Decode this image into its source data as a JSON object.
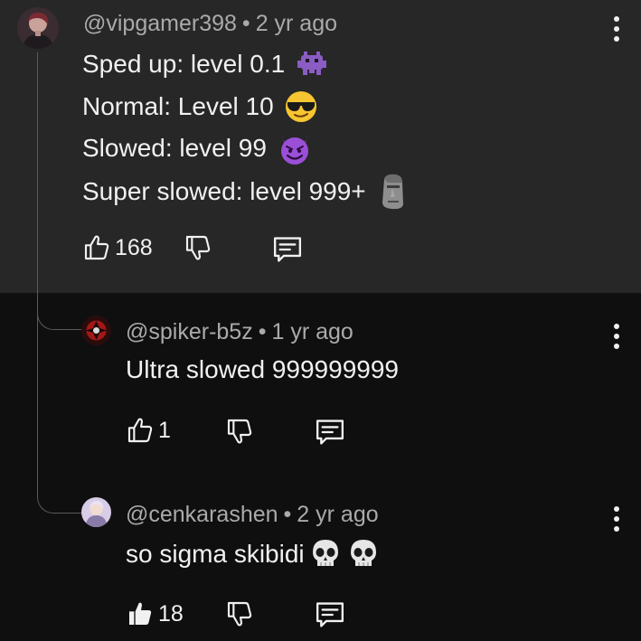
{
  "comments": [
    {
      "author": "@vipgamer398",
      "time": "2 yr ago",
      "lines": [
        "Sped up: level 0.1",
        "Normal: Level 10",
        "Slowed: level 99",
        "Super slowed: level 999+"
      ],
      "emojis": [
        "alien-monster-icon",
        "sunglasses-face-icon",
        "smiling-devil-icon",
        "moai-icon"
      ],
      "likes": "168"
    },
    {
      "author": "@spiker-b5z",
      "time": "1 yr ago",
      "lines": [
        "Ultra slowed 999999999"
      ],
      "likes": "1"
    },
    {
      "author": "@cenkarashen",
      "time": "2 yr ago",
      "lines": [
        "so sigma skibidi"
      ],
      "emojis": [
        "skull-icon",
        "skull-icon"
      ],
      "likes": "18",
      "liked": true
    }
  ],
  "separator": "•",
  "colors": {
    "top_comment_bg": "#272727",
    "page_bg": "#0f0f0f",
    "text": "#f1f1f1",
    "meta": "#aaaaaa"
  }
}
